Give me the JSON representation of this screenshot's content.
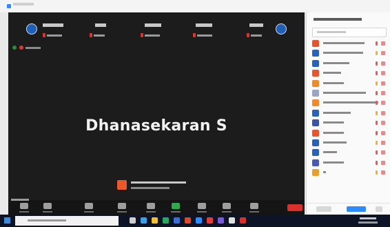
{
  "window": {
    "title": ""
  },
  "meeting": {
    "active_speaker": "Dhanasekaran S",
    "recording_label": "",
    "share_notice": {
      "line1": "",
      "line2": ""
    },
    "gallery_tiles": [
      {
        "name": "",
        "sub": ""
      },
      {
        "name": "",
        "sub": ""
      },
      {
        "name": "",
        "sub": ""
      },
      {
        "name": "",
        "sub": ""
      },
      {
        "name": "",
        "sub": ""
      }
    ]
  },
  "toolbar": {
    "room_label": "",
    "buttons": [
      {
        "icon": "microphone-icon",
        "label": ""
      },
      {
        "icon": "video-camera-icon",
        "label": ""
      },
      {
        "icon": "security-icon",
        "label": ""
      },
      {
        "icon": "participants-icon",
        "label": ""
      },
      {
        "icon": "chat-icon",
        "label": ""
      },
      {
        "icon": "share-screen-icon",
        "label": ""
      },
      {
        "icon": "record-icon",
        "label": ""
      },
      {
        "icon": "breakout-rooms-icon",
        "label": ""
      },
      {
        "icon": "reactions-icon",
        "label": ""
      }
    ],
    "end_label": ""
  },
  "participants_panel": {
    "title": "",
    "search_placeholder": "",
    "participants": [
      {
        "name": "",
        "avatar_color": "#e8542e"
      },
      {
        "name": "",
        "avatar_color": "#2a62b8"
      },
      {
        "name": "",
        "avatar_color": "#2a62b8"
      },
      {
        "name": "",
        "avatar_color": "#e8542e"
      },
      {
        "name": "",
        "avatar_color": "#f08a2a"
      },
      {
        "name": "",
        "avatar_color": "#9aa7c4"
      },
      {
        "name": "",
        "avatar_color": "#f08a2a"
      },
      {
        "name": "",
        "avatar_color": "#2a62b8"
      },
      {
        "name": "",
        "avatar_color": "#3a52a8"
      },
      {
        "name": "",
        "avatar_color": "#e8542e"
      },
      {
        "name": "",
        "avatar_color": "#2a62b8"
      },
      {
        "name": "",
        "avatar_color": "#2a62b8"
      },
      {
        "name": "",
        "avatar_color": "#4a58b8"
      },
      {
        "name": "",
        "avatar_color": "#e8a02a"
      }
    ],
    "footer": {
      "invite": "",
      "mute_all": "",
      "more": ""
    }
  },
  "taskbar": {
    "search_placeholder": "",
    "clock_time": "",
    "clock_date": ""
  },
  "colors": {
    "stage": "#1c1c1c",
    "accent": "#2d8cff",
    "end": "#d9302c"
  }
}
